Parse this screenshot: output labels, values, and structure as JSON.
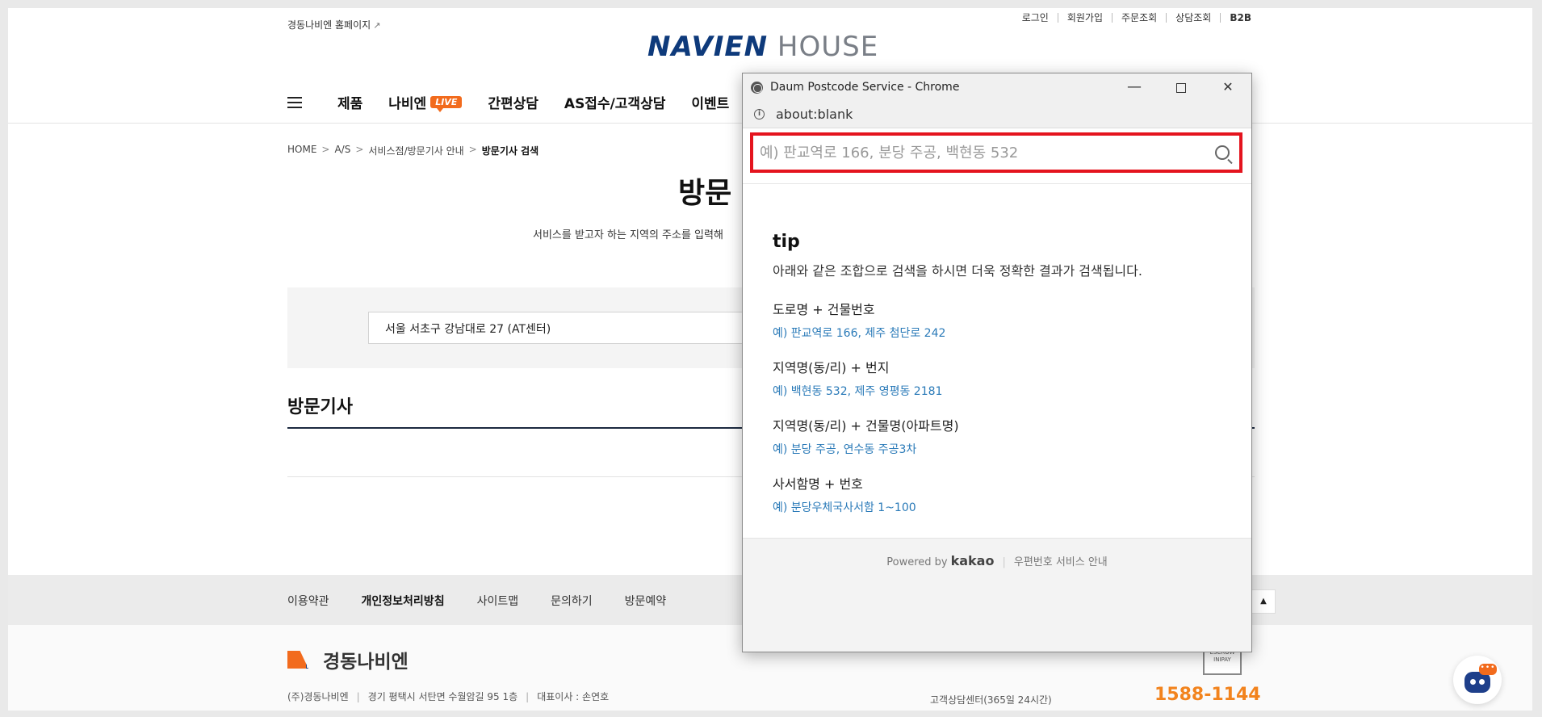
{
  "header": {
    "home_link": "경동나비엔 홈페이지",
    "util_links": [
      "로그인",
      "회원가입",
      "주문조회",
      "상담조회",
      "B2B"
    ],
    "logo_brand": "NAVIEN",
    "logo_house": "HOUSE"
  },
  "gnb": {
    "items": [
      "제품",
      "나비엔",
      "간편상담",
      "AS접수/고객상담",
      "이벤트"
    ],
    "live_badge": "LIVE"
  },
  "breadcrumb": {
    "items": [
      "HOME",
      "A/S",
      "서비스점/방문기사 안내",
      "방문기사 검색"
    ],
    "separator": ">"
  },
  "main": {
    "title": "방문",
    "description": "서비스를 받고자 하는 지역의 주소를 입력해",
    "address_value": "서울 서초구 강남대로 27 (AT센터)",
    "section_title": "방문기사"
  },
  "footer": {
    "links": [
      "이용약관",
      "개인정보처리방침",
      "사이트맵",
      "문의하기",
      "방문예약"
    ],
    "top_button": "▲",
    "logo_text": "경동나비엔",
    "company": "(주)경동나비엔",
    "address": "경기 평택시 서탄면 수월암길 95 1층",
    "ceo": "대표이사 : 손연호",
    "cs_label": "고객상담센터(365일 24시간)",
    "cs_phone": "1588-1144",
    "escrow_top": "ESCROW",
    "escrow_bottom": "INIPAY",
    "chatbot_bubble": "•••"
  },
  "popup": {
    "window_title": "Daum Postcode Service - Chrome",
    "address_bar": "about:blank",
    "search_placeholder": "예) 판교역로 166, 분당 주공, 백현동 532",
    "tip_title": "tip",
    "tip_lead": "아래와 같은 조합으로 검색을 하시면 더욱 정확한 결과가 검색됩니다.",
    "tips": [
      {
        "title": "도로명 + 건물번호",
        "example": "예) 판교역로 166,  제주 첨단로 242"
      },
      {
        "title": "지역명(동/리) + 번지",
        "example": "예) 백현동 532,  제주 영평동 2181"
      },
      {
        "title": "지역명(동/리) + 건물명(아파트명)",
        "example": "예) 분당 주공,  연수동 주공3차"
      },
      {
        "title": "사서함명 + 번호",
        "example": "예) 분당우체국사서함 1~100"
      }
    ],
    "powered_by": "Powered by",
    "kakao": "kakao",
    "service_guide": "우편번호 서비스 안내"
  },
  "colors": {
    "highlight": "#e4141e",
    "brand_navy": "#0e3a7b",
    "accent_orange": "#f26b1d",
    "link_blue": "#2a7ab8"
  }
}
